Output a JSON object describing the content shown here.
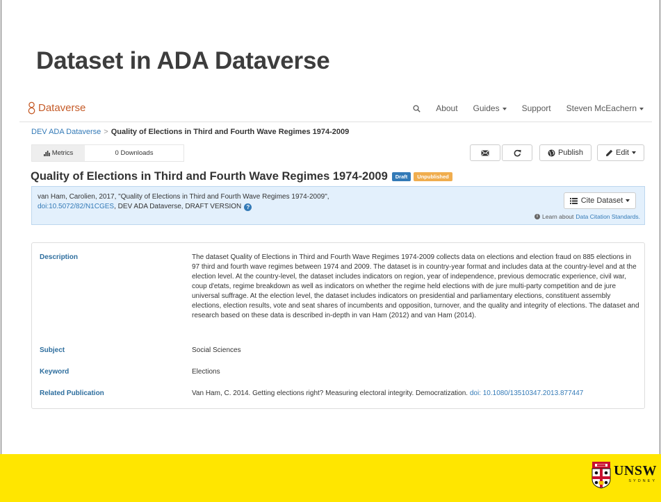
{
  "slide": {
    "title": "Dataset in ADA Dataverse"
  },
  "navbar": {
    "brand": "Dataverse",
    "items": [
      "About",
      "Guides",
      "Support",
      "Steven McEachern"
    ]
  },
  "breadcrumb": {
    "parent": "DEV ADA Dataverse",
    "separator": ">",
    "current": "Quality of Elections in Third and Fourth Wave Regimes 1974-2009"
  },
  "metrics": {
    "button_label": "Metrics",
    "downloads": "0 Downloads"
  },
  "actions": {
    "publish": "Publish",
    "edit": "Edit"
  },
  "dataset": {
    "title": "Quality of Elections in Third and Fourth Wave Regimes 1974-2009",
    "badge_draft": "Draft",
    "badge_unpublished": "Unpublished"
  },
  "citation": {
    "line1": "van Ham, Carolien, 2017, \"Quality of Elections in Third and Fourth Wave Regimes 1974-2009\",",
    "doi": "doi:10.5072/82/N1CGES",
    "line2_rest": ", DEV ADA Dataverse, DRAFT VERSION",
    "cite_button": "Cite Dataset",
    "learn_text": "Learn about",
    "learn_link": "Data Citation Standards."
  },
  "metadata": {
    "description_label": "Description",
    "description": "The dataset Quality of Elections in Third and Fourth Wave Regimes 1974-2009 collects data on elections and election fraud on 885 elections in 97 third and fourth wave regimes between 1974 and 2009. The dataset is in country-year format and includes data at the country-level and at the election level. At the country-level, the dataset includes indicators on region, year of independence, previous democratic experience, civil war, coup d'etats, regime breakdown as well as indicators on whether the regime held elections with de jure multi-party competition and de jure universal suffrage. At the election level, the dataset includes indicators on presidential and parliamentary elections, constituent assembly elections, election results, vote and seat shares of incumbents and opposition, turnover, and the quality and integrity of elections. The dataset and research based on these data is described in-depth in van Ham (2012) and van Ham (2014).",
    "subject_label": "Subject",
    "subject": "Social Sciences",
    "keyword_label": "Keyword",
    "keyword": "Elections",
    "related_label": "Related Publication",
    "related_text": "Van Ham, C. 2014. Getting elections right? Measuring electoral integrity. Democratization.",
    "related_doi": "doi: 10.1080/13510347.2013.877447"
  },
  "footer": {
    "logo_word": "UNSW",
    "logo_sub": "SYDNEY"
  }
}
